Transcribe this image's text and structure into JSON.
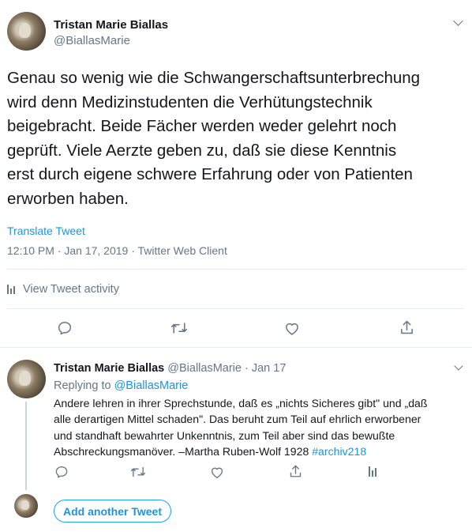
{
  "main_tweet": {
    "author_name": "Tristan Marie Biallas",
    "author_handle": "@BiallasMarie",
    "text": "Genau so wenig wie die Schwangerschaftsunterbrechung\nwird denn Medizinstudenten die Verhütungstechnik\nbeigebracht. Beide Fächer werden weder gelehrt noch\ngeprüft. Viele Aerzte geben zu, daß sie diese Kenntnis\nerst durch eigene schwere Erfahrung oder von Patienten\nerworben haben.",
    "translate_label": "Translate Tweet",
    "meta": "12:10 PM · Jan 17, 2019 · Twitter Web Client",
    "activity_label": "View Tweet activity"
  },
  "reply_tweet": {
    "author_name": "Tristan Marie Biallas",
    "author_handle_date": "@BiallasMarie · Jan 17",
    "replying_to_prefix": "Replying to ",
    "replying_to_handle": "@BiallasMarie",
    "text": "Andere lehren in ihrer Sprechstunde, daß es „nichts Sicheres  gibt\" und „daß\nalle derartigen Mittel schaden\". Das beruht zum Teil auf  ehrlich erworbener\nund standhaft bewahrter Unkenntnis, zum Teil aber  sind das bewußte\nAbschreckungsmanöver. –Martha Ruben-Wolf 1928  ",
    "hashtag": "#archiv218"
  },
  "composer": {
    "add_button_label": "Add another Tweet"
  },
  "icons": {
    "reply": "reply-icon",
    "retweet": "retweet-icon",
    "like": "heart-icon",
    "share": "share-icon",
    "analytics": "analytics-icon",
    "more": "chevron-down-icon"
  },
  "colors": {
    "link": "#1b95e0",
    "secondary_text": "#657786",
    "primary_text": "#14171a",
    "divider": "#e6ecf0",
    "button_border": "#1da1f2"
  }
}
